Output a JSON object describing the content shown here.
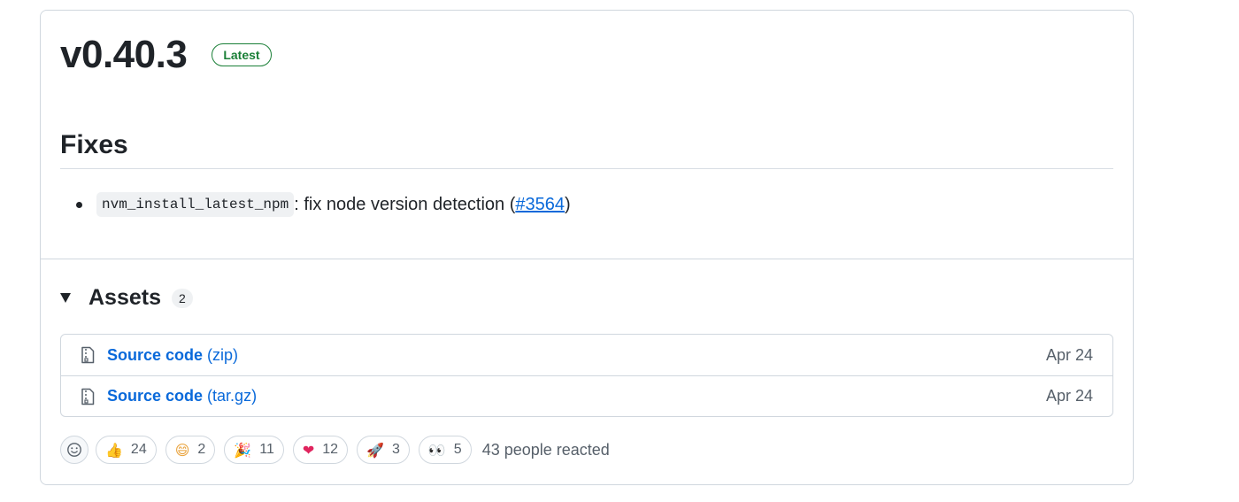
{
  "release": {
    "version": "v0.40.3",
    "badge": "Latest"
  },
  "notes": {
    "heading": "Fixes",
    "items": [
      {
        "code": "nvm_install_latest_npm",
        "text": ": fix node version detection (",
        "link": "#3564",
        "tail": ")"
      }
    ]
  },
  "assets": {
    "heading": "Assets",
    "count": "2",
    "items": [
      {
        "name": "Source code",
        "ext": "(zip)",
        "date": "Apr 24",
        "icon": "file-zip-icon"
      },
      {
        "name": "Source code",
        "ext": "(tar.gz)",
        "date": "Apr 24",
        "icon": "file-zip-icon"
      }
    ]
  },
  "reactions": {
    "items": [
      {
        "emoji": "👍",
        "count": "24",
        "icon": "thumbs-up-icon",
        "color": "#e6a23c"
      },
      {
        "emoji": "😄",
        "count": "2",
        "icon": "laugh-icon",
        "color": "#e9a23b"
      },
      {
        "emoji": "🎉",
        "count": "11",
        "icon": "hooray-icon",
        "color": "#c0392b"
      },
      {
        "emoji": "❤",
        "count": "12",
        "icon": "heart-icon",
        "color": "#e0245e"
      },
      {
        "emoji": "🚀",
        "count": "3",
        "icon": "rocket-icon",
        "color": "#a05a9c"
      },
      {
        "emoji": "👀",
        "count": "5",
        "icon": "eyes-icon",
        "color": "#4b3f72"
      }
    ],
    "summary": "43 people reacted"
  },
  "colors": {
    "link": "#0969da",
    "latest_badge": "#1a7f37",
    "border": "#d0d7de"
  }
}
